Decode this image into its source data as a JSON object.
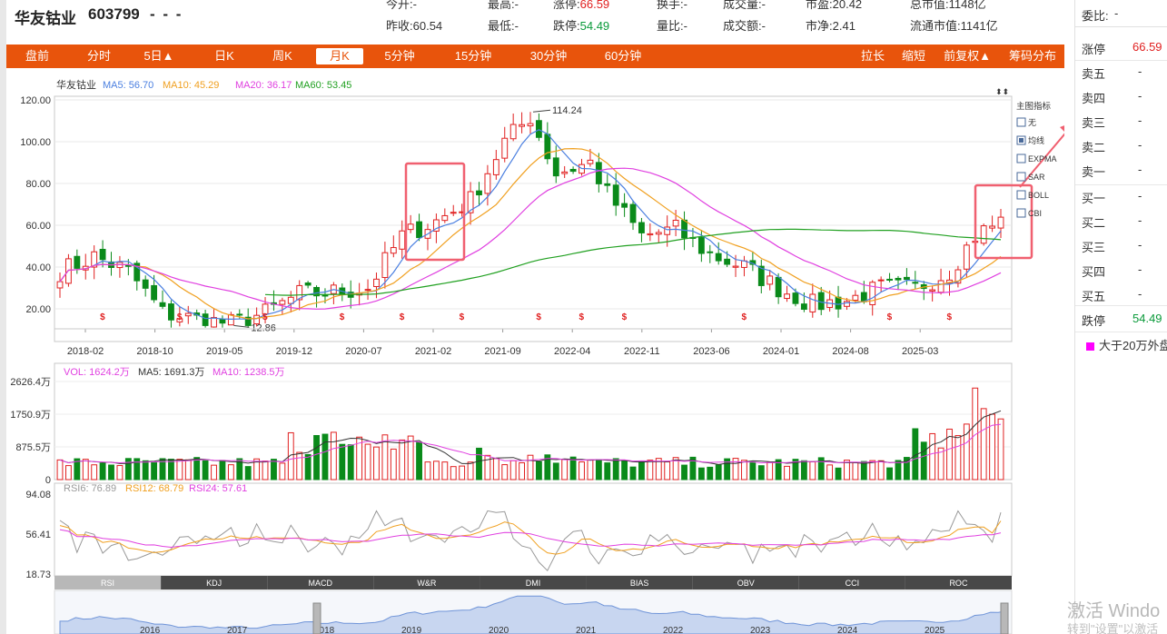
{
  "header": {
    "name": "华友钴业",
    "code": "603799",
    "price": "- - -",
    "row1": [
      {
        "label": "今开:",
        "value": "-",
        "cls": "v"
      },
      {
        "label": "最高:",
        "value": "-",
        "cls": "v"
      },
      {
        "label": "涨停:",
        "value": "66.59",
        "cls": "red"
      },
      {
        "label": "换手:",
        "value": "-",
        "cls": "v"
      },
      {
        "label": "成交量:",
        "value": "-",
        "cls": "v"
      },
      {
        "label": "市盈:",
        "value": "20.42",
        "cls": "v"
      },
      {
        "label": "总市值:",
        "value": "1148亿",
        "cls": "v"
      }
    ],
    "row2": [
      {
        "label": "昨收:",
        "value": "60.54",
        "cls": "v"
      },
      {
        "label": "最低:",
        "value": "-",
        "cls": "v"
      },
      {
        "label": "跌停:",
        "value": "54.49",
        "cls": "green"
      },
      {
        "label": "量比:",
        "value": "-",
        "cls": "v"
      },
      {
        "label": "成交额:",
        "value": "-",
        "cls": "v"
      },
      {
        "label": "市净:",
        "value": "2.41",
        "cls": "v"
      },
      {
        "label": "流通市值:",
        "value": "1141亿",
        "cls": "v"
      }
    ]
  },
  "toolbar": {
    "left": [
      "盘前",
      "分时",
      "5日▲",
      "日K",
      "周K",
      "月K",
      "5分钟",
      "15分钟",
      "30分钟",
      "60分钟"
    ],
    "active": "月K",
    "right": [
      "拉长",
      "缩短",
      "前复权▲",
      "筹码分布"
    ]
  },
  "right_panel": {
    "weibi_label": "委比:",
    "weibi_value": "-",
    "zhangting_label": "涨停",
    "zhangting_value": "66.59",
    "sell": [
      {
        "label": "卖五",
        "value": "-"
      },
      {
        "label": "卖四",
        "value": "-"
      },
      {
        "label": "卖三",
        "value": "-"
      },
      {
        "label": "卖二",
        "value": "-"
      },
      {
        "label": "卖一",
        "value": "-"
      }
    ],
    "buy": [
      {
        "label": "买一",
        "value": "-"
      },
      {
        "label": "买二",
        "value": "-"
      },
      {
        "label": "买三",
        "value": "-"
      },
      {
        "label": "买四",
        "value": "-"
      },
      {
        "label": "买五",
        "value": "-"
      }
    ],
    "dieting_label": "跌停",
    "dieting_value": "54.49",
    "legend_label": "大于20万外盘",
    "legend_color": "#ff00ff"
  },
  "main_chart": {
    "stock_label": "华友钴业",
    "ma_legend": [
      {
        "text": "MA5: 56.70",
        "color": "#4a7fe0"
      },
      {
        "text": "MA10: 45.29",
        "color": "#f0a020"
      },
      {
        "text": "MA20: 36.17",
        "color": "#e040e0"
      },
      {
        "text": "MA60: 53.45",
        "color": "#20a020"
      }
    ],
    "y_ticks": [
      "120.00",
      "100.00",
      "80.00",
      "60.00",
      "40.00",
      "20.00"
    ],
    "x_ticks": [
      "2018-02",
      "2018-10",
      "2019-05",
      "2019-12",
      "2020-07",
      "2021-02",
      "2021-09",
      "2022-04",
      "2022-11",
      "2023-06",
      "2024-01",
      "2024-08",
      "2025-03"
    ],
    "high_label": "114.24",
    "low_label": "12.86",
    "indicator_title": "主图指标",
    "indicators": [
      {
        "label": "无",
        "checked": false
      },
      {
        "label": "均线",
        "checked": true
      },
      {
        "label": "EXPMA",
        "checked": false
      },
      {
        "label": "SAR",
        "checked": false
      },
      {
        "label": "BOLL",
        "checked": false
      },
      {
        "label": "CBI",
        "checked": false
      }
    ]
  },
  "volume_chart": {
    "legend": [
      {
        "text": "VOL: 1624.2万",
        "color": "#e040e0"
      },
      {
        "text": "MA5: 1691.3万",
        "color": "#333333"
      },
      {
        "text": "MA10: 1238.5万",
        "color": "#e040e0"
      }
    ],
    "y_ticks": [
      "2626.4万",
      "1750.9万",
      "875.5万",
      "0"
    ]
  },
  "rsi_chart": {
    "legend": [
      {
        "text": "RSI6: 76.89",
        "color": "#999999"
      },
      {
        "text": "RSI12: 68.79",
        "color": "#f0a020"
      },
      {
        "text": "RSI24: 57.61",
        "color": "#e040e0"
      }
    ],
    "y_ticks": [
      "94.08",
      "56.41",
      "18.73"
    ]
  },
  "indicator_tabs": [
    "RSI",
    "KDJ",
    "MACD",
    "W&R",
    "DMI",
    "BIAS",
    "OBV",
    "CCI",
    "ROC"
  ],
  "active_tab": "RSI",
  "navigator": {
    "labels": [
      "2016",
      "2017",
      "2018",
      "2019",
      "2020",
      "2021",
      "2022",
      "2023",
      "2024",
      "2025"
    ]
  },
  "watermark": {
    "line1": "激活 Windo",
    "line2": "转到\"设置\"以激活"
  },
  "colors": {
    "up": "#e02020",
    "down": "#0a8a1a",
    "accent": "#e8540c",
    "highlight": "#f06070"
  }
}
